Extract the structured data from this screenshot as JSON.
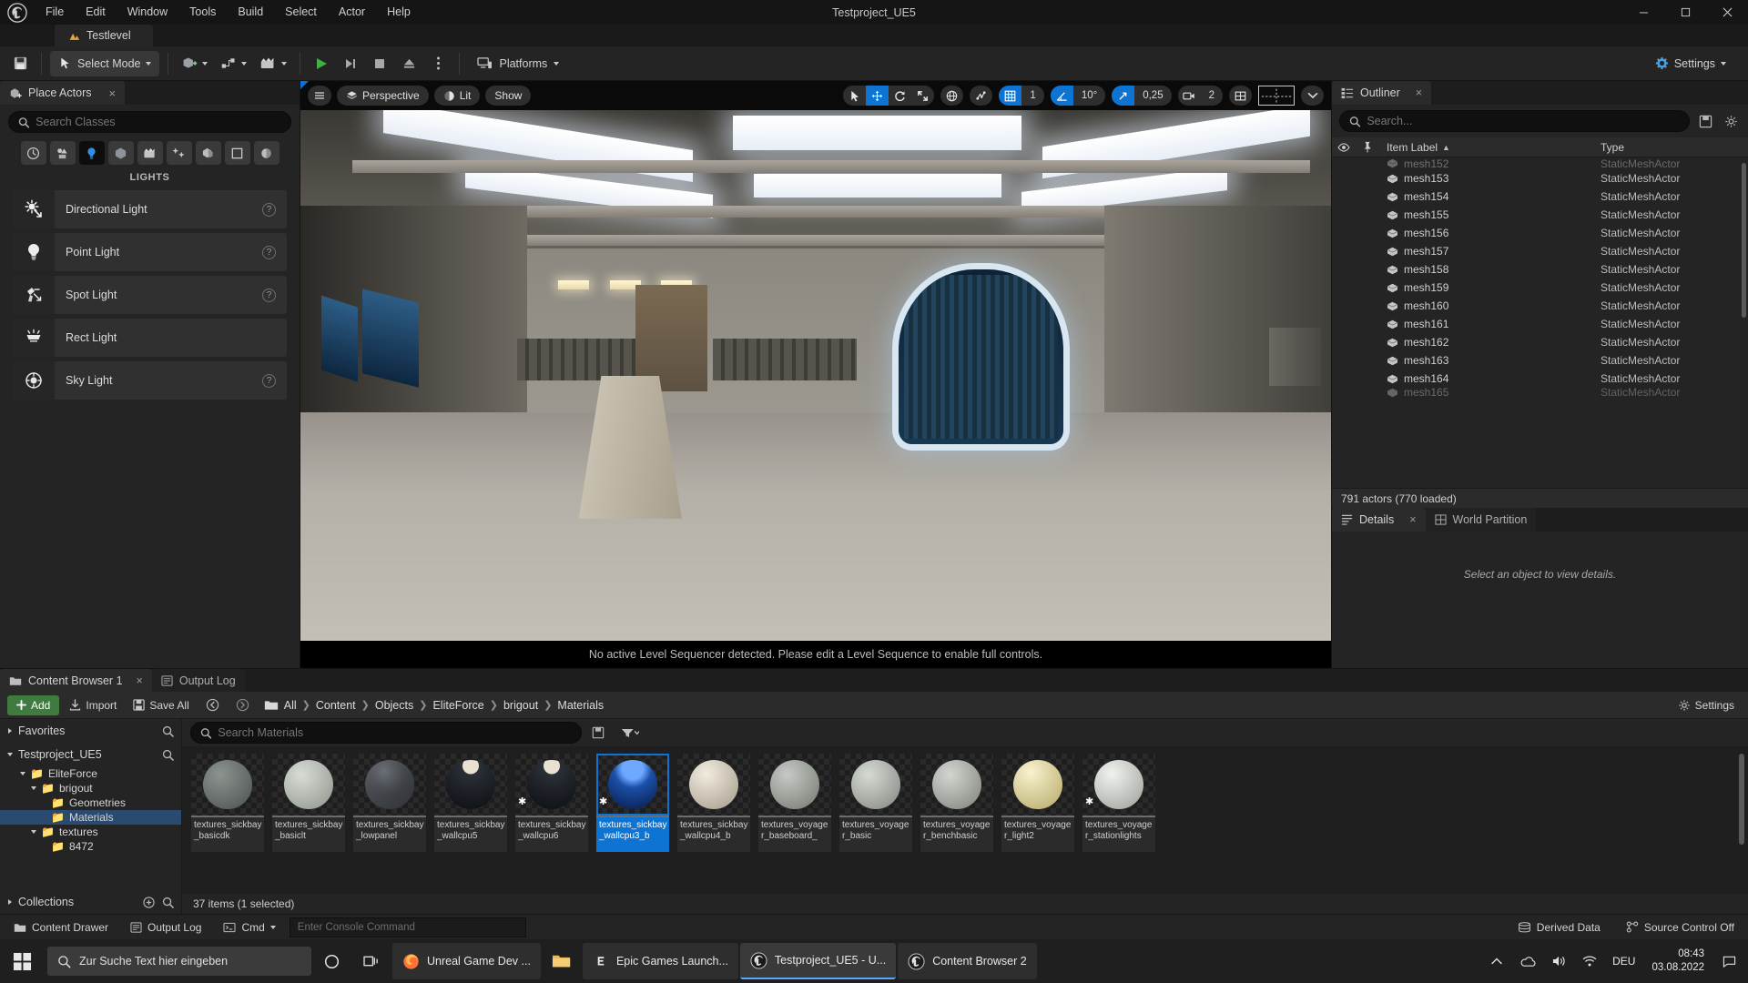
{
  "window": {
    "project_title": "Testproject_UE5",
    "minimize_label": "Minimize",
    "maximize_label": "Maximize",
    "close_label": "Close"
  },
  "menu": {
    "items": [
      "File",
      "Edit",
      "Window",
      "Tools",
      "Build",
      "Select",
      "Actor",
      "Help"
    ]
  },
  "level_tab": {
    "label": "Testlevel"
  },
  "toolbar": {
    "save_label": "Save",
    "mode_label": "Select Mode",
    "platforms_label": "Platforms",
    "settings_label": "Settings",
    "play_label": "Play",
    "skip_label": "Skip",
    "stop_label": "Stop",
    "eject_label": "Eject",
    "more_label": "More",
    "add_label": "Add",
    "blueprints_label": "Blueprints",
    "cinematics_label": "Cinematics"
  },
  "place_actors": {
    "tab_label": "Place Actors",
    "close_label": "×",
    "search_placeholder": "Search Classes",
    "categories": [
      {
        "name": "recently-placed",
        "icon": "clock-icon"
      },
      {
        "name": "basic",
        "icon": "basic-shapes-icon"
      },
      {
        "name": "lights",
        "icon": "lightbulb-icon",
        "active": true
      },
      {
        "name": "shapes",
        "icon": "cube-icon"
      },
      {
        "name": "cinematic",
        "icon": "clapboard-icon"
      },
      {
        "name": "visual-effects",
        "icon": "sparkle-icon"
      },
      {
        "name": "geometry",
        "icon": "geometry-icon"
      },
      {
        "name": "volumes",
        "icon": "volume-icon"
      },
      {
        "name": "all-classes",
        "icon": "allclasses-icon"
      }
    ],
    "section_label": "LIGHTS",
    "actors": [
      {
        "label": "Directional Light",
        "icon": "directional-light-icon",
        "help": "?"
      },
      {
        "label": "Point Light",
        "icon": "point-light-icon",
        "help": "?"
      },
      {
        "label": "Spot Light",
        "icon": "spot-light-icon",
        "help": "?"
      },
      {
        "label": "Rect Light",
        "icon": "rect-light-icon",
        "help": ""
      },
      {
        "label": "Sky Light",
        "icon": "sky-light-icon",
        "help": "?"
      }
    ]
  },
  "viewport": {
    "menu_label": "Viewport Options",
    "perspective_label": "Perspective",
    "lit_label": "Lit",
    "show_label": "Show",
    "transform_tools": [
      {
        "name": "select-tool",
        "selected": false
      },
      {
        "name": "translate-tool",
        "selected": true
      },
      {
        "name": "rotate-tool",
        "selected": false
      },
      {
        "name": "scale-tool",
        "selected": false
      }
    ],
    "coordinate_system": "world-icon",
    "surface_snap": "surface-snap-icon",
    "grid_snap_enabled": true,
    "grid_snap_value": "1",
    "angle_snap_enabled": true,
    "angle_snap_value": "10°",
    "scale_snap_enabled": true,
    "scale_snap_value": "0,25",
    "camera_speed_value": "2",
    "maximize_label": "Maximize Viewport",
    "layout_label": "Layout",
    "sequencer_message": "No active Level Sequencer detected. Please edit a Level Sequence to enable full controls."
  },
  "outliner": {
    "tab_label": "Outliner",
    "close_label": "×",
    "search_placeholder": "Search...",
    "columns": {
      "visibility": "eye-icon",
      "pin": "pin-icon",
      "item_label": "Item Label",
      "sort": "▲",
      "type": "Type"
    },
    "rows": [
      {
        "label": "mesh152",
        "type": "StaticMeshActor"
      },
      {
        "label": "mesh153",
        "type": "StaticMeshActor"
      },
      {
        "label": "mesh154",
        "type": "StaticMeshActor"
      },
      {
        "label": "mesh155",
        "type": "StaticMeshActor"
      },
      {
        "label": "mesh156",
        "type": "StaticMeshActor"
      },
      {
        "label": "mesh157",
        "type": "StaticMeshActor"
      },
      {
        "label": "mesh158",
        "type": "StaticMeshActor"
      },
      {
        "label": "mesh159",
        "type": "StaticMeshActor"
      },
      {
        "label": "mesh160",
        "type": "StaticMeshActor"
      },
      {
        "label": "mesh161",
        "type": "StaticMeshActor"
      },
      {
        "label": "mesh162",
        "type": "StaticMeshActor"
      },
      {
        "label": "mesh163",
        "type": "StaticMeshActor"
      },
      {
        "label": "mesh164",
        "type": "StaticMeshActor"
      },
      {
        "label": "mesh165",
        "type": "StaticMeshActor"
      }
    ],
    "status": "791 actors (770 loaded)"
  },
  "details": {
    "tab_label": "Details",
    "close_label": "×",
    "world_partition_label": "World Partition",
    "empty_message": "Select an object to view details."
  },
  "content_browser": {
    "tab_label": "Content Browser 1",
    "close_label": "×",
    "output_log_tab": "Output Log",
    "add_label": "Add",
    "import_label": "Import",
    "save_all_label": "Save All",
    "settings_label": "Settings",
    "breadcrumb": [
      "All",
      "Content",
      "Objects",
      "EliteForce",
      "brigout",
      "Materials"
    ],
    "search_placeholder": "Search Materials",
    "favorites_label": "Favorites",
    "project_label": "Testproject_UE5",
    "collections_label": "Collections",
    "tree": [
      {
        "label": "EliteForce",
        "depth": 1,
        "selected": false
      },
      {
        "label": "brigout",
        "depth": 2,
        "selected": false
      },
      {
        "label": "Geometries",
        "depth": 3,
        "selected": false
      },
      {
        "label": "Materials",
        "depth": 3,
        "selected": true
      },
      {
        "label": "textures",
        "depth": 2,
        "selected": false
      },
      {
        "label": "8472",
        "depth": 3,
        "selected": false
      }
    ],
    "assets": [
      {
        "label": "textures_sickbay_basicdk",
        "color1": "#8d9490",
        "color2": "#4b514e",
        "star": false,
        "selected": false
      },
      {
        "label": "textures_sickbay_basiclt",
        "color1": "#d8dcd6",
        "color2": "#8e938c",
        "star": false,
        "selected": false
      },
      {
        "label": "textures_sickbay_lowpanel",
        "color1": "#4a4d50",
        "color2": "#15171a",
        "star": false,
        "selected": false
      },
      {
        "label": "textures_sickbay_wallcpu5",
        "color1": "#2a2f36",
        "color2": "#0c0e12",
        "star": false,
        "selected": false
      },
      {
        "label": "textures_sickbay_wallcpu6",
        "color1": "#2a2f36",
        "color2": "#0c0e12",
        "star": true,
        "selected": false
      },
      {
        "label": "textures_sickbay_wallcpu3_b",
        "color1": "#1b4fa8",
        "color2": "#081b45",
        "star": true,
        "selected": true
      },
      {
        "label": "textures_sickbay_wallcpu4_b",
        "color1": "#e8e2d4",
        "color2": "#a39a88",
        "star": false,
        "selected": false
      },
      {
        "label": "textures_voyager_baseboard_",
        "color1": "#b9bdb8",
        "color2": "#73776f",
        "star": false,
        "selected": false
      },
      {
        "label": "textures_voyager_basic",
        "color1": "#cfd3cd",
        "color2": "#82867f",
        "star": false,
        "selected": false
      },
      {
        "label": "textures_voyager_benchbasic",
        "color1": "#c9cdc7",
        "color2": "#7d817a",
        "star": false,
        "selected": false
      },
      {
        "label": "textures_voyager_light2",
        "color1": "#f3e9b8",
        "color2": "#b5a866",
        "star": false,
        "selected": false
      },
      {
        "label": "textures_voyager_stationlights",
        "color1": "#e4e6e2",
        "color2": "#9b9e98",
        "star": true,
        "selected": false
      }
    ],
    "status": "37 items (1 selected)"
  },
  "statusbar": {
    "content_drawer_label": "Content Drawer",
    "output_log_label": "Output Log",
    "cmd_label": "Cmd",
    "cmd_placeholder": "Enter Console Command",
    "derived_data_label": "Derived Data",
    "source_control_label": "Source Control Off"
  },
  "taskbar": {
    "search_placeholder": "Zur Suche Text hier eingeben",
    "cortana_label": "Cortana",
    "taskview_label": "Task View",
    "apps": [
      {
        "label": "Unreal Game Dev ...",
        "icon": "firefox-icon",
        "active": false
      },
      {
        "label": "",
        "icon": "explorer-icon",
        "active": false
      },
      {
        "label": "Epic Games Launch...",
        "icon": "epic-icon",
        "active": false
      },
      {
        "label": "Testproject_UE5 - U...",
        "icon": "ue-icon",
        "active": true
      },
      {
        "label": "Content Browser 2",
        "icon": "ue-icon",
        "active": false
      }
    ],
    "language": "DEU",
    "clock_time": "08:43",
    "clock_date": "03.08.2022"
  }
}
